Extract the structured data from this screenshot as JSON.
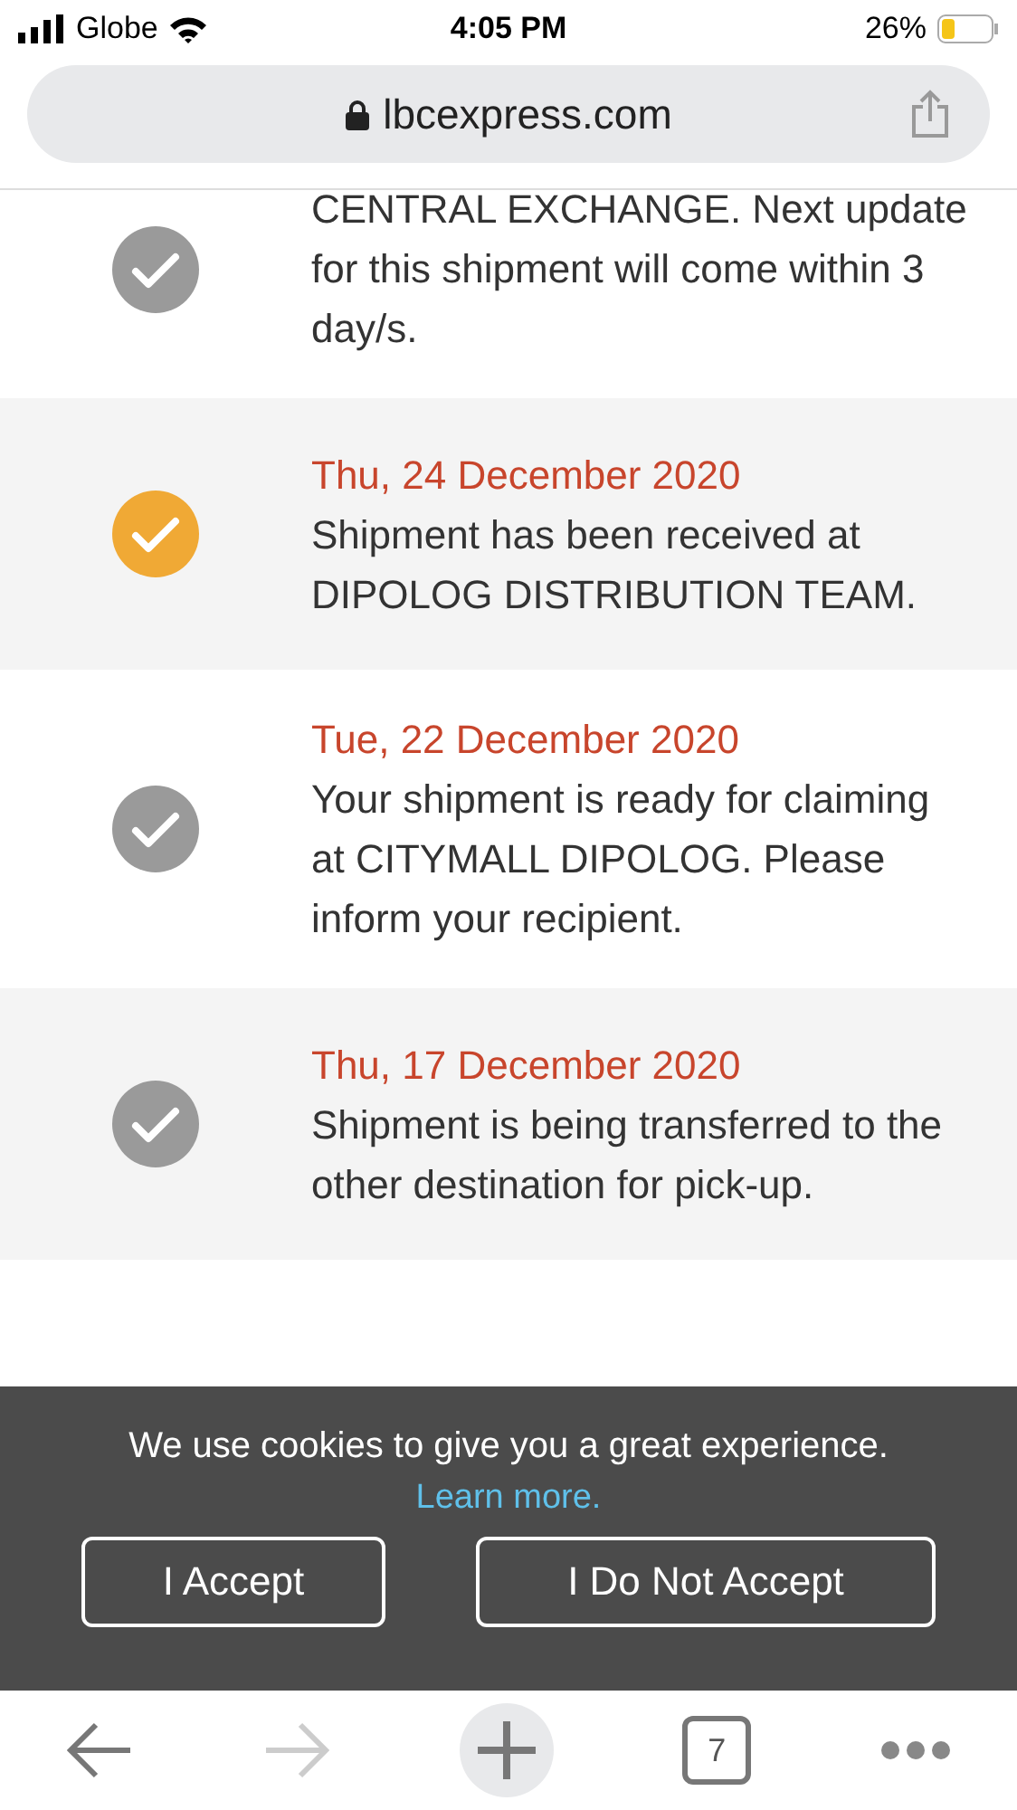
{
  "status_bar": {
    "carrier": "Globe",
    "time": "4:05 PM",
    "battery": "26%"
  },
  "address_bar": {
    "url": "lbcexpress.com"
  },
  "events": [
    {
      "message": "CENTRAL EXCHANGE. Next update for this shipment will come within 3 day/s.",
      "current": false
    },
    {
      "date": "Thu, 24 December 2020",
      "message": "Shipment has been received at DIPOLOG DISTRIBUTION TEAM.",
      "current": true
    },
    {
      "date": "Tue, 22 December 2020",
      "message": "Your shipment is ready for claiming at CITYMALL DIPOLOG. Please inform your recipient.",
      "current": false
    },
    {
      "date": "Thu, 17 December 2020",
      "message": "Shipment is being transferred to the other destination for pick-up.",
      "current": false
    }
  ],
  "cookie_banner": {
    "message": "We use cookies to give you a great experience.",
    "link": "Learn more.",
    "buttons": [
      "I Accept",
      "I Do Not Accept"
    ]
  },
  "toolbar": {
    "tab_count": "7"
  }
}
